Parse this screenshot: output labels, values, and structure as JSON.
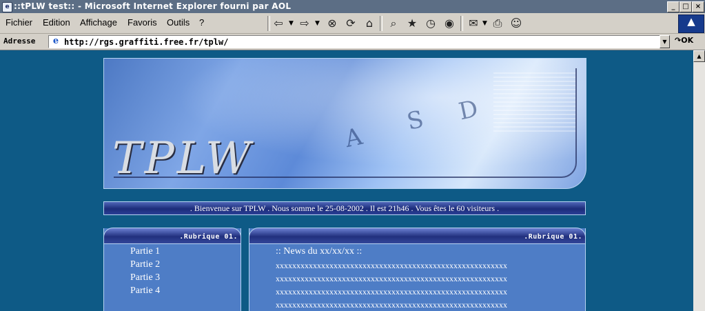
{
  "window": {
    "title": "::tPLW test:: - Microsoft Internet Explorer fourni par AOL",
    "controls": [
      "_",
      "□",
      "×"
    ]
  },
  "menu": {
    "items": [
      {
        "label": "Fichier"
      },
      {
        "label": "Edition"
      },
      {
        "label": "Affichage"
      },
      {
        "label": "Favoris"
      },
      {
        "label": "Outils"
      },
      {
        "label": "?"
      }
    ]
  },
  "toolbar": {
    "icons": [
      "back-arrow-icon",
      "forward-arrow-icon",
      "stop-icon",
      "refresh-icon",
      "home-icon",
      "search-icon",
      "favorites-icon",
      "history-icon",
      "media-icon",
      "mail-icon",
      "print-icon",
      "messenger-icon"
    ]
  },
  "address": {
    "label": "Adresse",
    "url": "http://rgs.graffiti.free.fr/tplw/",
    "go_label": "OK"
  },
  "page": {
    "banner_logo": "TPLW",
    "banner_keys": [
      "A",
      "S",
      "D"
    ],
    "welcome": ". Bienvenue sur TPLW . Nous somme le 25-08-2002 . Il est 21h46 . Vous êtes le 60 visiteurs .",
    "left_panel": {
      "heading": ".Rubrique 01.",
      "items": [
        "Partie 1",
        "Partie 2",
        "Partie 3",
        "Partie 4"
      ]
    },
    "right_panel": {
      "heading": ".Rubrique 01.",
      "news_title": ":: News du xx/xx/xx ::",
      "lines": [
        "xxxxxxxxxxxxxxxxxxxxxxxxxxxxxxxxxxxxxxxxxxxxxxxxxxxxxxxx",
        "xxxxxxxxxxxxxxxxxxxxxxxxxxxxxxxxxxxxxxxxxxxxxxxxxxxxxxxx",
        "xxxxxxxxxxxxxxxxxxxxxxxxxxxxxxxxxxxxxxxxxxxxxxxxxxxxxxxx",
        "xxxxxxxxxxxxxxxxxxxxxxxxxxxxxxxxxxxxxxxxxxxxxxxxxxxxxxxx"
      ]
    }
  }
}
